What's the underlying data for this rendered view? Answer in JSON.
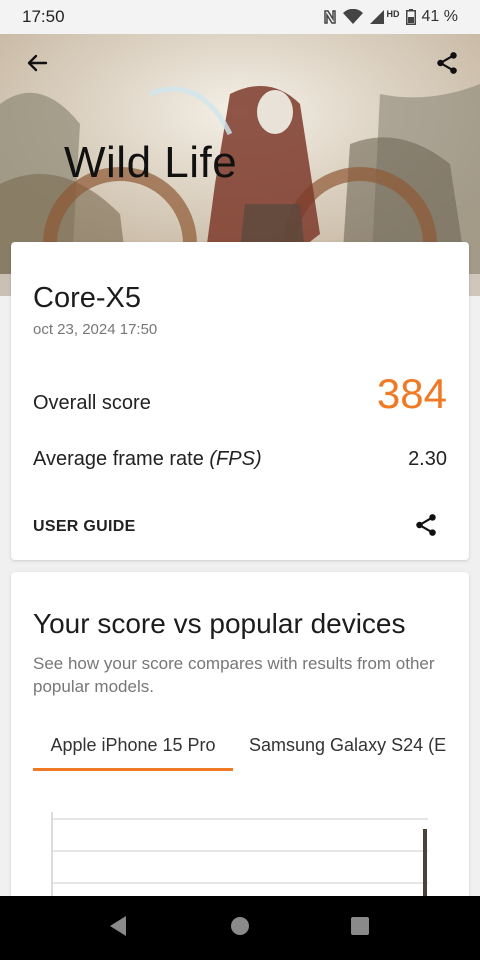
{
  "status_bar": {
    "time": "17:50",
    "network_label": "HD",
    "battery_text": "41 %",
    "icons": [
      "nfc-icon",
      "wifi-icon",
      "signal-icon",
      "battery-icon"
    ]
  },
  "hero": {
    "title": "Wild Life",
    "back_icon": "arrow-left-icon",
    "share_icon": "share-icon"
  },
  "result_card": {
    "device_name": "Core-X5",
    "date": "oct 23, 2024 17:50",
    "overall_score_label": "Overall score",
    "overall_score_value": "384",
    "fps_label_prefix": "Average frame rate ",
    "fps_label_unit": "(FPS)",
    "fps_value": "2.30",
    "user_guide_label": "USER GUIDE"
  },
  "compare_card": {
    "title": "Your score vs popular devices",
    "description": "See how your score compares with results from other popular models.",
    "tabs": [
      {
        "label": "Apple iPhone 15 Pro",
        "active": true
      },
      {
        "label": "Samsung Galaxy S24 (E",
        "active": false
      }
    ]
  },
  "colors": {
    "accent": "#f07a24",
    "text_primary": "#1c1c1c",
    "text_secondary": "#777777"
  },
  "nav_bar": {
    "icons": [
      "nav-back-icon",
      "nav-home-icon",
      "nav-recents-icon"
    ]
  }
}
